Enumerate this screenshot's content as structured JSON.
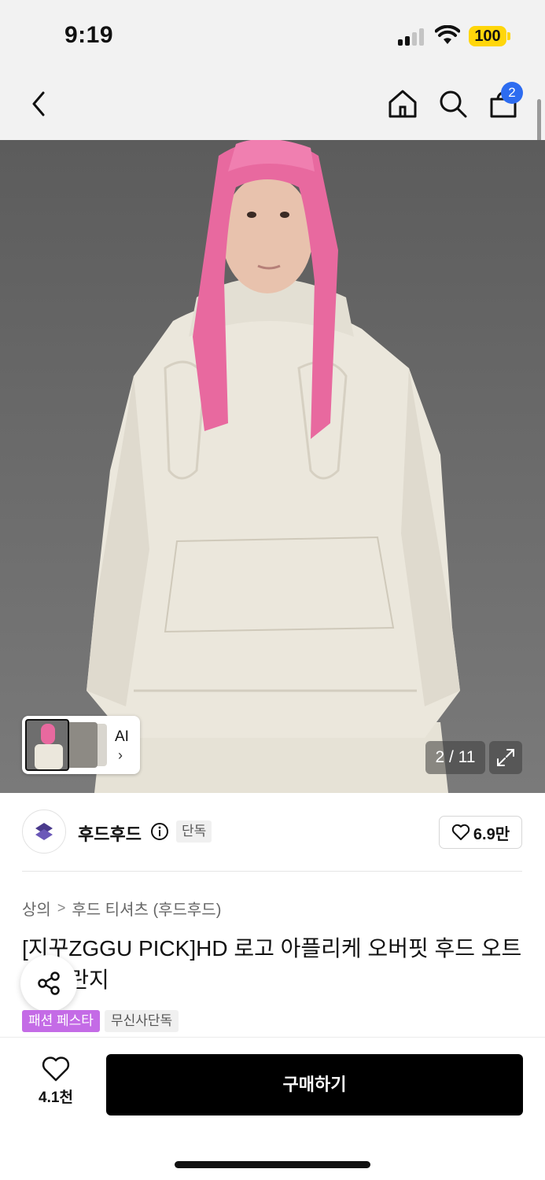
{
  "status_bar": {
    "time": "9:19",
    "battery": "100",
    "battery_color": "#ffd60a"
  },
  "header": {
    "back_icon": "chevron-left-icon",
    "home_icon": "home-icon",
    "search_icon": "search-icon",
    "cart_icon": "shopping-bag-icon",
    "cart_count": "2",
    "badge_color": "#2d6cf0"
  },
  "gallery": {
    "current": "2 / 11",
    "thumb_label": "AI",
    "expand_icon": "expand-icon"
  },
  "brand": {
    "name": "후드후드",
    "exclusive_tag": "단독",
    "likes": "6.9만"
  },
  "product": {
    "breadcrumb": [
      "상의",
      "후드 티셔츠 (후드후드)"
    ],
    "title": "[지꾸ZGGU PICK]HD 로고 아플리케 오버핏 후드 오트밀 멜란지",
    "tags": [
      "패션 페스타",
      "무신사단독"
    ],
    "festa_color": "#c46be6"
  },
  "bottom_bar": {
    "wish_count": "4.1천",
    "buy_label": "구매하기"
  }
}
